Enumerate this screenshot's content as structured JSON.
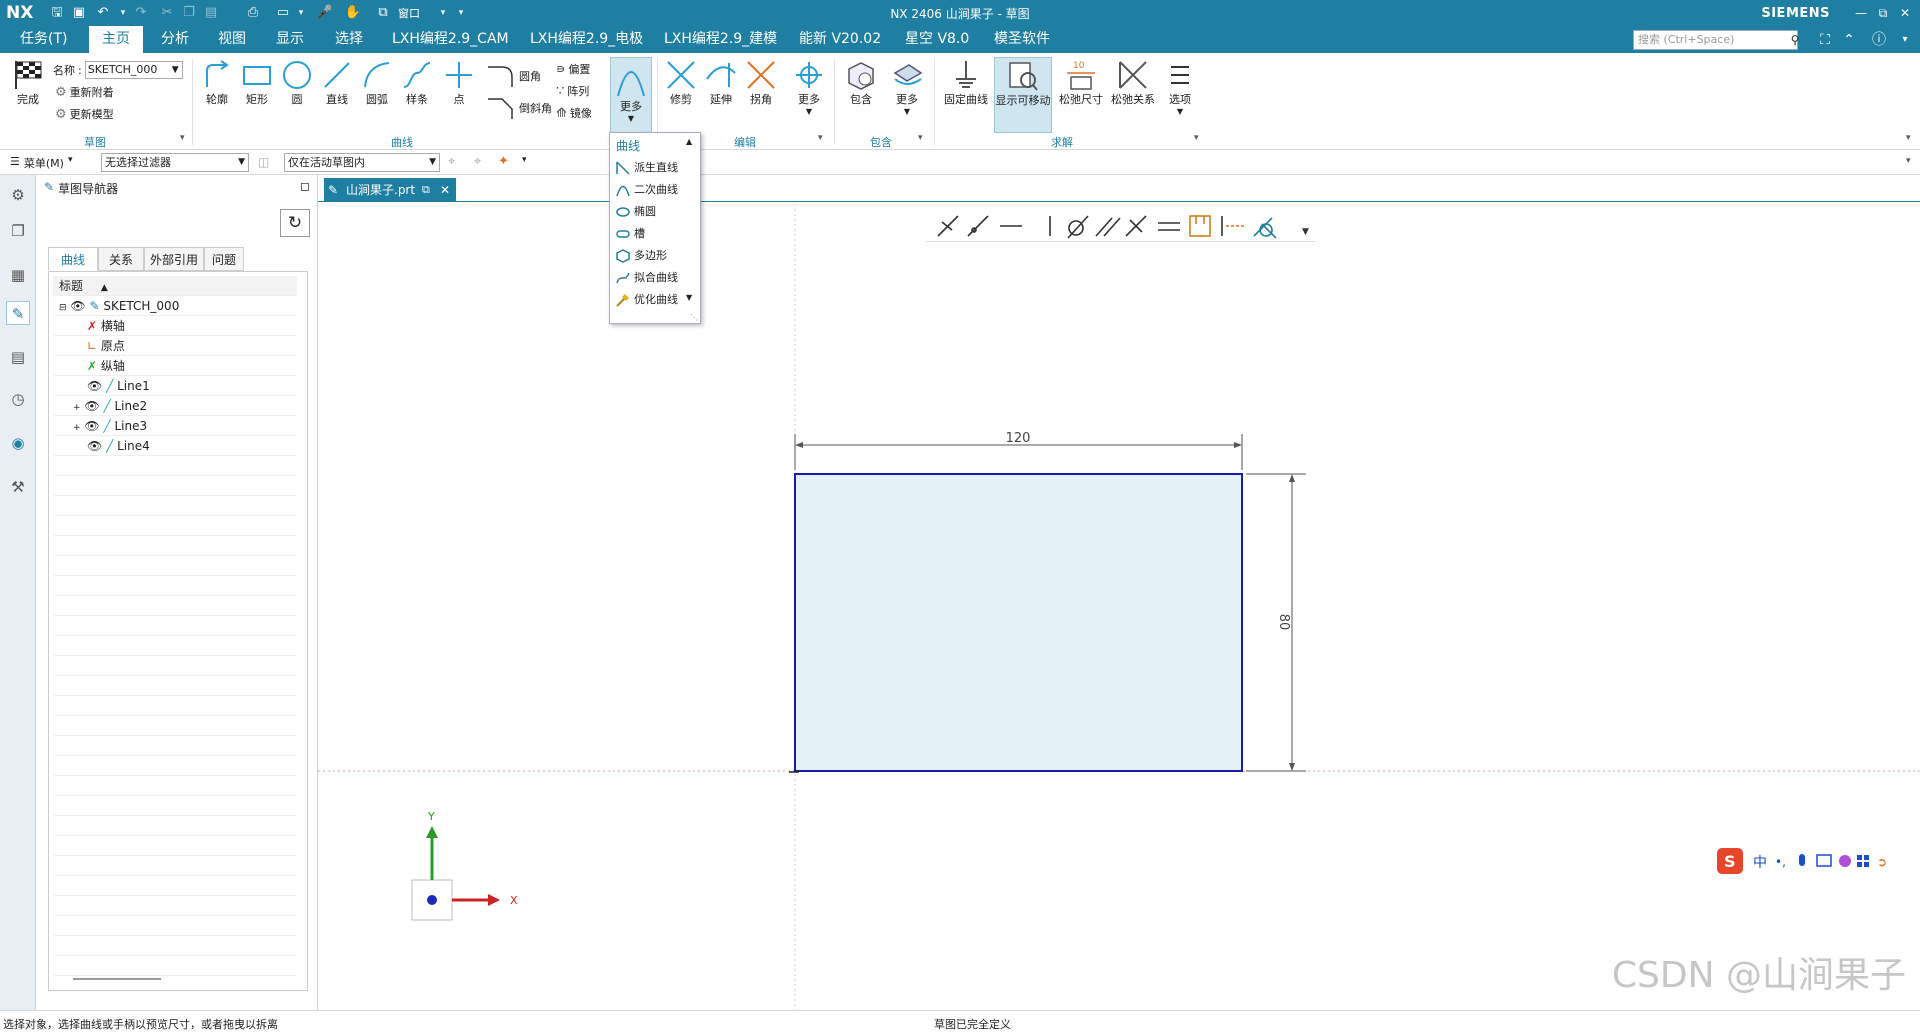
{
  "titlebar": {
    "app_logo": "NX",
    "title": "NX 2406 山涧果子 - 草图",
    "brand": "SIEMENS",
    "window_menu_label": "窗口",
    "buttons": [
      "minimize-icon",
      "restore-icon",
      "close-icon"
    ]
  },
  "menubar": {
    "tabs": [
      "任务(T)",
      "主页",
      "分析",
      "视图",
      "显示",
      "选择",
      "LXH编程2.9_CAM",
      "LXH编程2.9_电极",
      "LXH编程2.9_建模",
      "能新 V20.02",
      "星空 V8.0",
      "模圣软件"
    ],
    "active_tab": "主页",
    "search_placeholder": "搜索 (Ctrl+Space)"
  },
  "ribbon": {
    "finish_label": "完成",
    "name_label": "名称",
    "sketch_name": "SKETCH_000",
    "reattach_label": "重新附着",
    "update_model_label": "更新模型",
    "group_sketch": "草图",
    "curve_tools": [
      "轮廓",
      "矩形",
      "圆",
      "直线",
      "圆弧",
      "样条",
      "点"
    ],
    "fillet_label": "圆角",
    "chamfer_label": "倒斜角",
    "offset_label": "偏置",
    "pattern_label": "阵列",
    "mirror_label": "镜像",
    "more_label": "更多",
    "group_curve": "曲线",
    "edit_tools": [
      "修剪",
      "延伸",
      "拐角"
    ],
    "group_edit": "编辑",
    "wrap_label": "包含",
    "group_wrap": "包含",
    "solve_tools": [
      "固定曲线",
      "显示可移动",
      "松弛尺寸",
      "松弛关系",
      "选项"
    ],
    "group_solve": "求解"
  },
  "toolbar2": {
    "menu_label": "菜单(M)",
    "filter_value": "无选择过滤器",
    "scope_value": "仅在活动草图内"
  },
  "navigator": {
    "title": "草图导航器",
    "tabs": [
      "曲线",
      "关系",
      "外部引用",
      "问题"
    ],
    "active_tab": "曲线",
    "column_header": "标题",
    "tree": [
      {
        "label": "SKETCH_000",
        "level": 0
      },
      {
        "label": "横轴",
        "level": 1
      },
      {
        "label": "原点",
        "level": 1
      },
      {
        "label": "纵轴",
        "level": 1
      },
      {
        "label": "Line1",
        "level": 1
      },
      {
        "label": "Line2",
        "level": 1
      },
      {
        "label": "Line3",
        "level": 1
      },
      {
        "label": "Line4",
        "level": 1
      }
    ]
  },
  "document": {
    "tab_label": "山涧果子.prt"
  },
  "dropdown": {
    "header": "曲线",
    "items": [
      "派生直线",
      "二次曲线",
      "椭圆",
      "槽",
      "多边形",
      "拟合曲线",
      "优化曲线"
    ]
  },
  "sketch": {
    "dim_width": "120",
    "dim_height": "80",
    "axis_x": "X",
    "axis_y": "Y",
    "fill_color": "#e3f1f7",
    "line_color": "#1a1aa8"
  },
  "statusbar": {
    "left_text": "选择对象，选择曲线或手柄以预览尺寸，或者拖曳以拆离",
    "center_text": "草图已完全定义"
  },
  "ime": {
    "label": "中"
  },
  "watermark": "CSDN @山涧果子",
  "colors": {
    "accent": "#1f7fa3"
  }
}
